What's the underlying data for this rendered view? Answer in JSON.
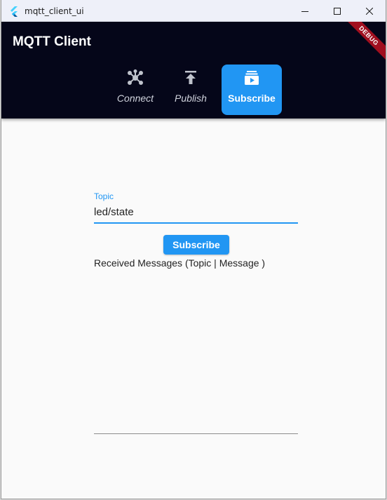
{
  "window": {
    "title": "mqtt_client_ui",
    "controls": [
      "minimize-icon",
      "maximize-icon",
      "close-icon"
    ]
  },
  "appbar": {
    "title": "MQTT Client",
    "background": "#050619",
    "debug_banner": "DEBUG",
    "nav": [
      {
        "label": "Connect",
        "icon": "hub-icon",
        "active": false
      },
      {
        "label": "Publish",
        "icon": "publish-icon",
        "active": false
      },
      {
        "label": "Subscribe",
        "icon": "subscriptions-icon",
        "active": true
      }
    ]
  },
  "accent": "#2196f3",
  "subscribe_form": {
    "topic_label": "Topic",
    "topic_value": "led/state",
    "button_label": "Subscribe",
    "received_label": "Received Messages (Topic | Message )",
    "messages": []
  }
}
